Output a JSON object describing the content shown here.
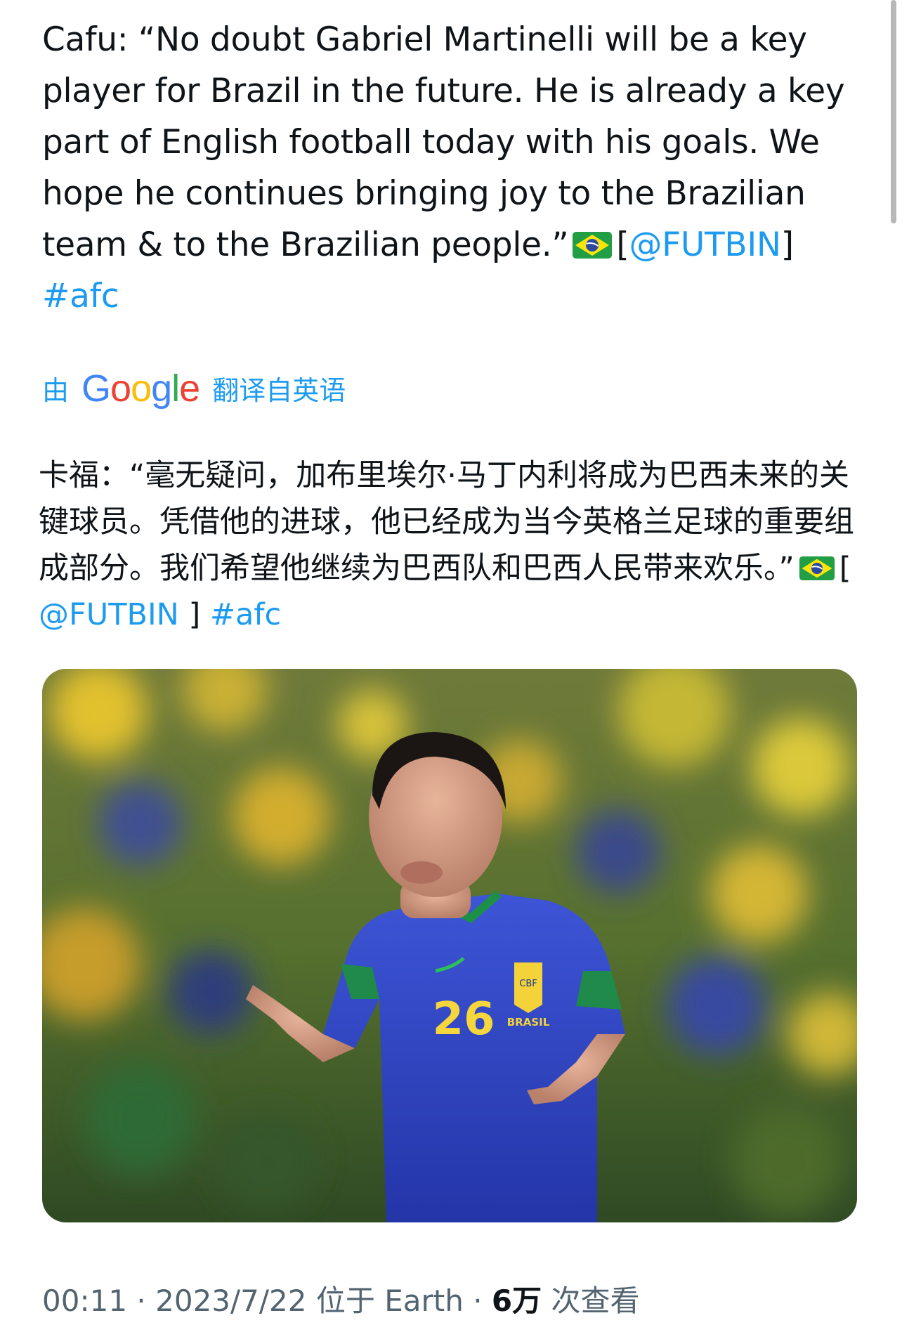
{
  "tweet": {
    "text_main": "Cafu: “No doubt Gabriel Martinelli will be a key player for Brazil in the future. He is already a key part of English football today with his goals. We hope he continues bringing joy to the Brazilian team & to the Brazilian people.”",
    "bracket_open": "[",
    "mention": "@FUTBIN",
    "bracket_close": "]",
    "hashtag": "#afc",
    "flag_icon": "brazil-flag-emoji"
  },
  "translation": {
    "prefix": "由",
    "provider": "Google",
    "suffix": "翻译自英语",
    "text": "卡福：“毫无疑问，加布里埃尔·马丁内利将成为巴西未来的关键球员。凭借他的进球，他已经成为当今英格兰足球的重要组成部分。我们希望他继续为巴西队和巴西人民带来欢乐。”",
    "bracket_open": "[",
    "mention": "@FUTBIN",
    "bracket_close": "]",
    "hashtag": "#afc"
  },
  "media": {
    "jersey_text": "BRASIL",
    "jersey_badge": "CBF",
    "shirt_number": "26"
  },
  "meta": {
    "time": "00:11",
    "date": "2023/7/22",
    "location": "位于 Earth",
    "views_count": "6万",
    "views_label": "次查看",
    "separator": "·"
  },
  "colors": {
    "link": "#1d9bf0",
    "text": "#0f1419",
    "muted": "#536471",
    "google_blue": "#4285f4",
    "google_red": "#ea4335",
    "google_yellow": "#fbbc05",
    "google_green": "#34a853"
  }
}
